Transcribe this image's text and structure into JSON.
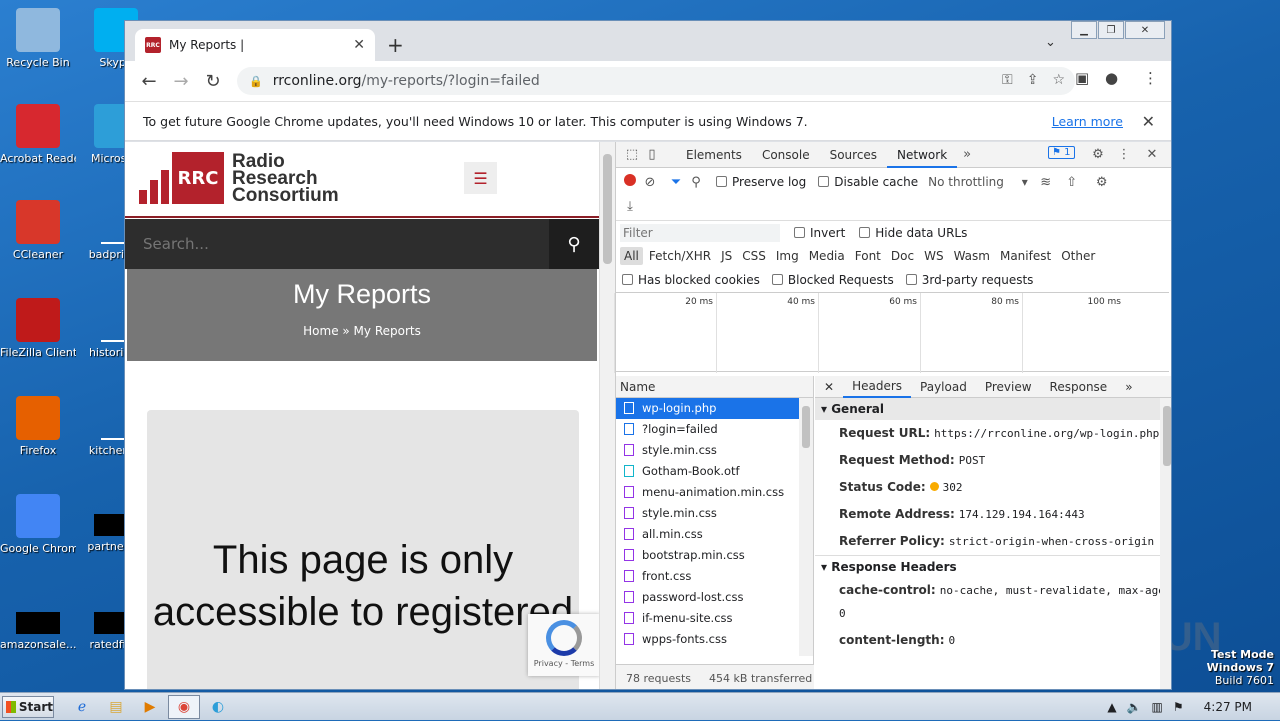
{
  "desktop": {
    "icons": [
      {
        "label": "Recycle Bin",
        "icon": "recycle-bin-icon",
        "color": "#8fb8de"
      },
      {
        "label": "Skype",
        "icon": "skype-icon",
        "color": "#00aff0"
      },
      {
        "label": "Acrobat Reader DC",
        "icon": "acrobat-icon",
        "color": "#d7282f"
      },
      {
        "label": "Microsoft",
        "icon": "edge-icon",
        "color": "#2d9ed8"
      },
      {
        "label": "CCleaner",
        "icon": "ccleaner-icon",
        "color": "#d8372a"
      },
      {
        "label": "badprivac",
        "icon": "doc-icon",
        "color": "#ffffff"
      },
      {
        "label": "FileZilla Client",
        "icon": "filezilla-icon",
        "color": "#bf1a1a"
      },
      {
        "label": "historicalf",
        "icon": "doc-icon",
        "color": "#ffffff"
      },
      {
        "label": "Firefox",
        "icon": "firefox-icon",
        "color": "#e66000"
      },
      {
        "label": "kitchenna",
        "icon": "doc-icon",
        "color": "#ffffff"
      },
      {
        "label": "Google Chrome",
        "icon": "chrome-icon",
        "color": "#4285f4"
      },
      {
        "label": "partnersm",
        "icon": "black-icon",
        "color": "#000000"
      },
      {
        "label": "amazonsale...",
        "icon": "black-icon",
        "color": "#000000"
      },
      {
        "label": "ratedfinal",
        "icon": "black-icon",
        "color": "#000000"
      }
    ]
  },
  "browser": {
    "tab_title": "My Reports |",
    "tab_favicon": "RRC",
    "url_host": "rrconline.org",
    "url_path": "/my-reports/?login=failed",
    "infobar_text": "To get future Google Chrome updates, you'll need Windows 10 or later. This computer is using Windows 7.",
    "infobar_link": "Learn more"
  },
  "site": {
    "logo_abbr": "RRC",
    "logo_line1": "Radio",
    "logo_line2": "Research",
    "logo_line3": "Consortium",
    "search_placeholder": "Search...",
    "page_title": "My Reports",
    "breadcrumb": "Home » My Reports",
    "message": "This page is only accessible to registered",
    "recaptcha_text": "Privacy - Terms"
  },
  "devtools": {
    "tabs": [
      "Elements",
      "Console",
      "Sources",
      "Network"
    ],
    "active_tab": "Network",
    "issues_count": "1",
    "preserve_log": "Preserve log",
    "disable_cache": "Disable cache",
    "throttling": "No throttling",
    "filter_placeholder": "Filter",
    "invert": "Invert",
    "hide_data_urls": "Hide data URLs",
    "filter_types": [
      "All",
      "Fetch/XHR",
      "JS",
      "CSS",
      "Img",
      "Media",
      "Font",
      "Doc",
      "WS",
      "Wasm",
      "Manifest",
      "Other"
    ],
    "has_blocked_cookies": "Has blocked cookies",
    "blocked_requests": "Blocked Requests",
    "third_party": "3rd-party requests",
    "timeline_ticks": [
      "20 ms",
      "40 ms",
      "60 ms",
      "80 ms",
      "100 ms"
    ],
    "name_header": "Name",
    "requests": [
      {
        "name": "wp-login.php",
        "type": "doc"
      },
      {
        "name": "?login=failed",
        "type": "doc"
      },
      {
        "name": "style.min.css",
        "type": "css"
      },
      {
        "name": "Gotham-Book.otf",
        "type": "font"
      },
      {
        "name": "menu-animation.min.css",
        "type": "css"
      },
      {
        "name": "style.min.css",
        "type": "css"
      },
      {
        "name": "all.min.css",
        "type": "css"
      },
      {
        "name": "bootstrap.min.css",
        "type": "css"
      },
      {
        "name": "front.css",
        "type": "css"
      },
      {
        "name": "password-lost.css",
        "type": "css"
      },
      {
        "name": "if-menu-site.css",
        "type": "css"
      },
      {
        "name": "wpps-fonts.css",
        "type": "css"
      }
    ],
    "status_requests": "78 requests",
    "status_transferred": "454 kB transferred",
    "detail_tabs": [
      "Headers",
      "Payload",
      "Preview",
      "Response"
    ],
    "general_title": "General",
    "general": [
      {
        "key": "Request URL:",
        "value": "https://rrconline.org/wp-login.php"
      },
      {
        "key": "Request Method:",
        "value": "POST"
      },
      {
        "key": "Status Code:",
        "value": "302"
      },
      {
        "key": "Remote Address:",
        "value": "174.129.194.164:443"
      },
      {
        "key": "Referrer Policy:",
        "value": "strict-origin-when-cross-origin"
      }
    ],
    "response_title": "Response Headers",
    "response": [
      {
        "key": "cache-control:",
        "value": "no-cache, must-revalidate, max-age=0"
      },
      {
        "key": "content-length:",
        "value": "0"
      }
    ]
  },
  "taskbar": {
    "start": "Start",
    "time": "4:27 PM"
  },
  "watermark": {
    "line1": "Test Mode",
    "line2": "Windows 7",
    "line3": "Build 7601",
    "brand": "ANY RUN"
  }
}
